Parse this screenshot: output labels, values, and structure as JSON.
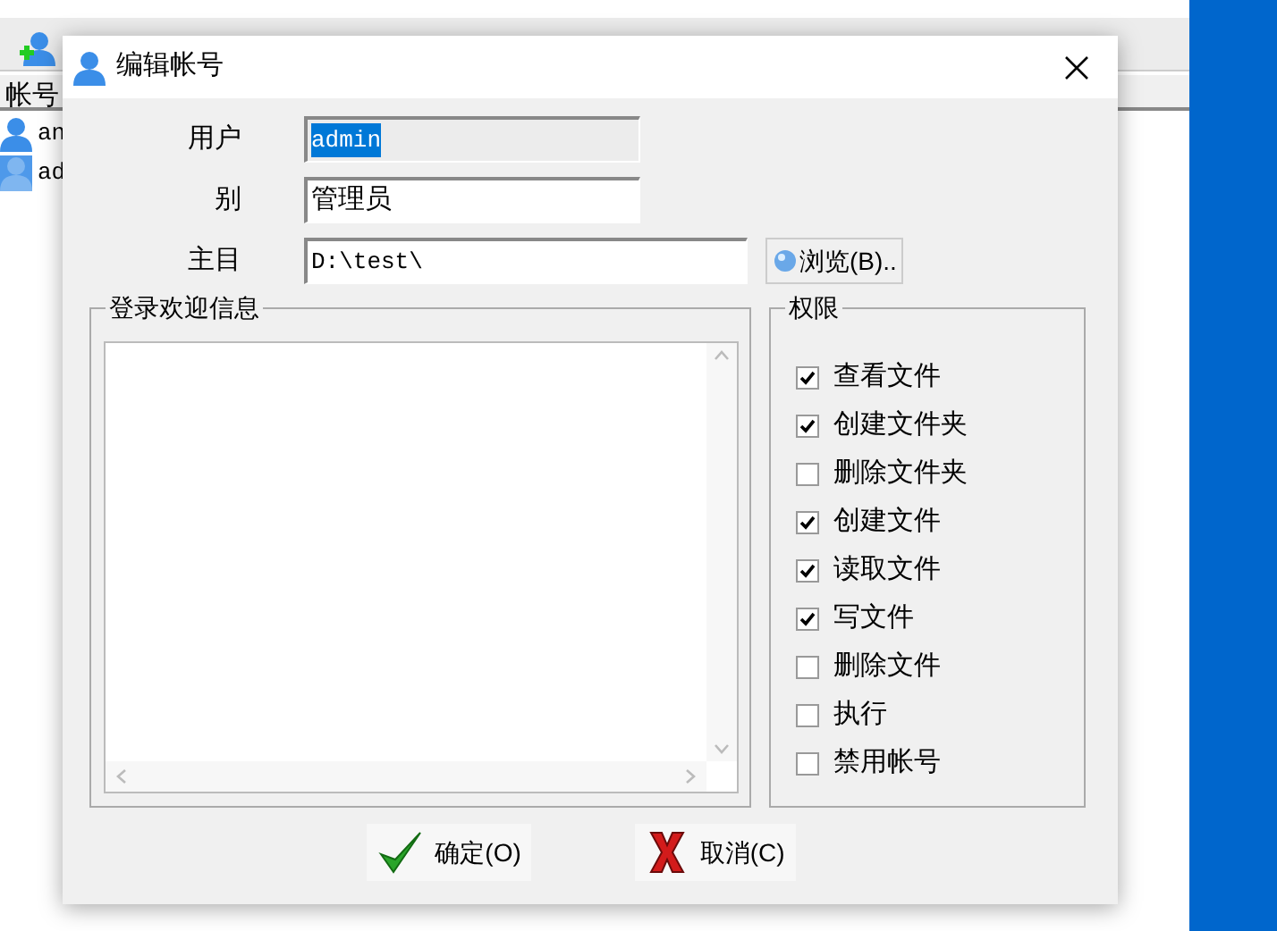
{
  "background_app": {
    "list_header": "帐号",
    "rows": [
      {
        "text": "an",
        "selected": false
      },
      {
        "text": "ad",
        "selected": true
      }
    ]
  },
  "dialog": {
    "title": "编辑帐号",
    "fields": [
      {
        "label": "用户",
        "value": "admin",
        "readonly": true,
        "selected_text": true
      },
      {
        "label": "别",
        "value": "管理员",
        "readonly": false,
        "selected_text": false
      },
      {
        "label": "主目",
        "value": "D:\\test\\",
        "readonly": false,
        "selected_text": false
      }
    ],
    "browse_button": "浏览(B)..",
    "welcome_group": {
      "title": "登录欢迎信息"
    },
    "permissions": {
      "title": "权限",
      "items": [
        {
          "label": "查看文件",
          "checked": true
        },
        {
          "label": "创建文件夹",
          "checked": true
        },
        {
          "label": "删除文件夹",
          "checked": false
        },
        {
          "label": "创建文件",
          "checked": true
        },
        {
          "label": "读取文件",
          "checked": true
        },
        {
          "label": "写文件",
          "checked": true
        },
        {
          "label": "删除文件",
          "checked": false
        },
        {
          "label": "执行",
          "checked": false
        },
        {
          "label": "禁用帐号",
          "checked": false
        }
      ]
    },
    "buttons": [
      {
        "kind": "ok",
        "label": "确定(O)"
      },
      {
        "kind": "cancel",
        "label": "取消(C)"
      }
    ]
  }
}
